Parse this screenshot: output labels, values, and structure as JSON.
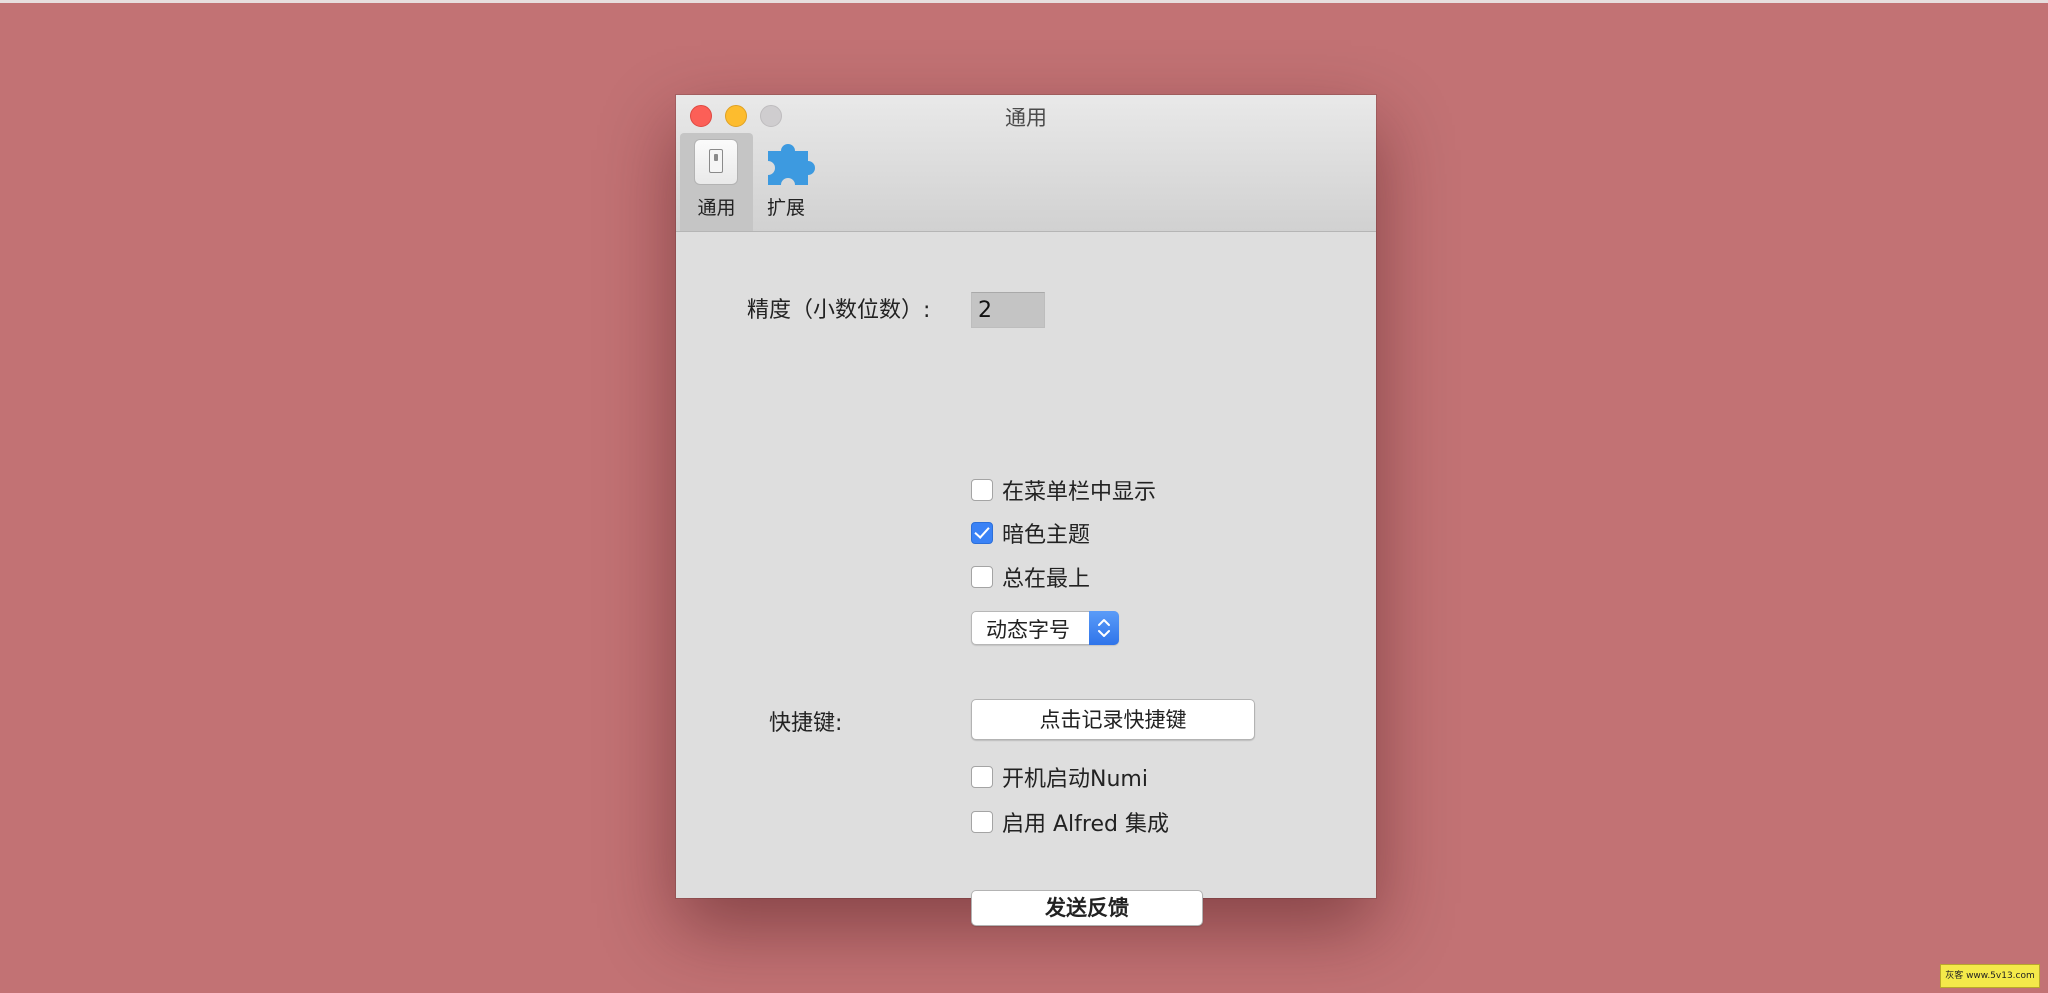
{
  "window": {
    "title": "通用"
  },
  "toolbar": {
    "items": [
      {
        "label": "通用",
        "icon": "switch-icon",
        "selected": true
      },
      {
        "label": "扩展",
        "icon": "puzzle-icon",
        "selected": false
      }
    ]
  },
  "settings": {
    "precision_label": "精度（小数位数）:",
    "precision_value": "2",
    "checkboxes": [
      {
        "label": "在菜单栏中显示",
        "checked": false
      },
      {
        "label": "暗色主题",
        "checked": true
      },
      {
        "label": "总在最上",
        "checked": false
      }
    ],
    "font_size_select": {
      "value": "动态字号"
    },
    "shortcut_label": "快捷键:",
    "record_shortcut_button": "点击记录快捷键",
    "login_checkboxes": [
      {
        "label": "开机启动Numi",
        "checked": false
      },
      {
        "label": "启用 Alfred 集成",
        "checked": false
      }
    ],
    "feedback_button": "发送反馈"
  },
  "watermark": {
    "text": "灰客 www.5v13.com"
  },
  "colors": {
    "background": "#c27274",
    "accent": "#3a82f6",
    "close": "#fc5f57",
    "minimize": "#fdbc2e",
    "zoom": "#cfcdcf",
    "puzzle": "#3d9ae0"
  }
}
